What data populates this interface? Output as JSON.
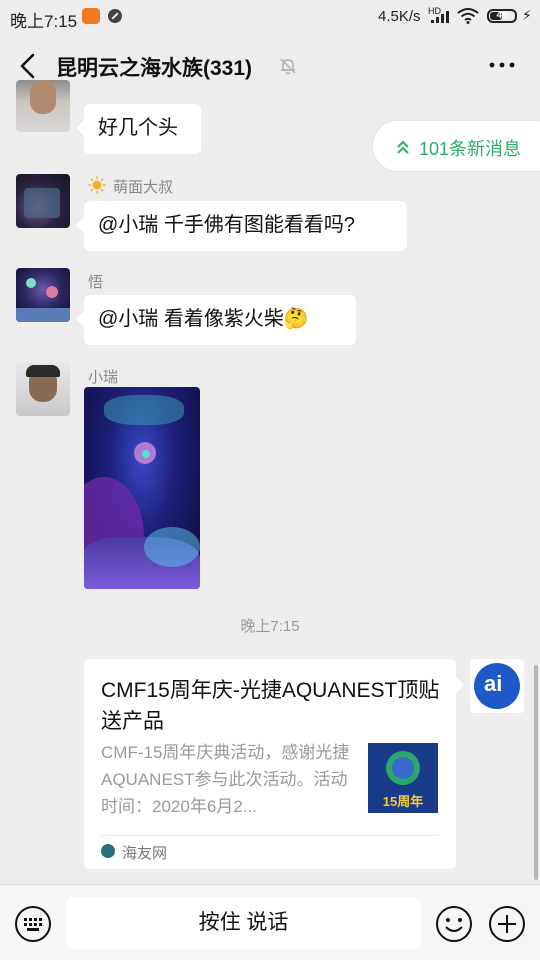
{
  "status_bar": {
    "time": "晚上7:15",
    "speed": "4.5K/s",
    "hd": "HD",
    "battery": "49"
  },
  "header": {
    "title": "昆明云之海水族(331)"
  },
  "new_messages": {
    "label": "101条新消息"
  },
  "messages": [
    {
      "sender": "",
      "text": "好几个头"
    },
    {
      "sender": "萌面大叔",
      "text": "@小瑞  千手佛有图能看看吗?"
    },
    {
      "sender": "悟",
      "text": "@小瑞  看着像紫火柴🤔"
    },
    {
      "sender": "小瑞",
      "text": ""
    }
  ],
  "timestamp": "晚上7:15",
  "card": {
    "title": "CMF15周年庆-光捷AQUANEST顶贴送产品",
    "description": "CMF-15周年庆典活动，感谢光捷AQUANEST参与此次活动。活动时间：2020年6月2...",
    "source": "海友网",
    "thumb_text": "15周年"
  },
  "input_bar": {
    "voice_label": "按住 说话"
  },
  "colors": {
    "accent": "#2aae67",
    "background": "#ededed"
  }
}
